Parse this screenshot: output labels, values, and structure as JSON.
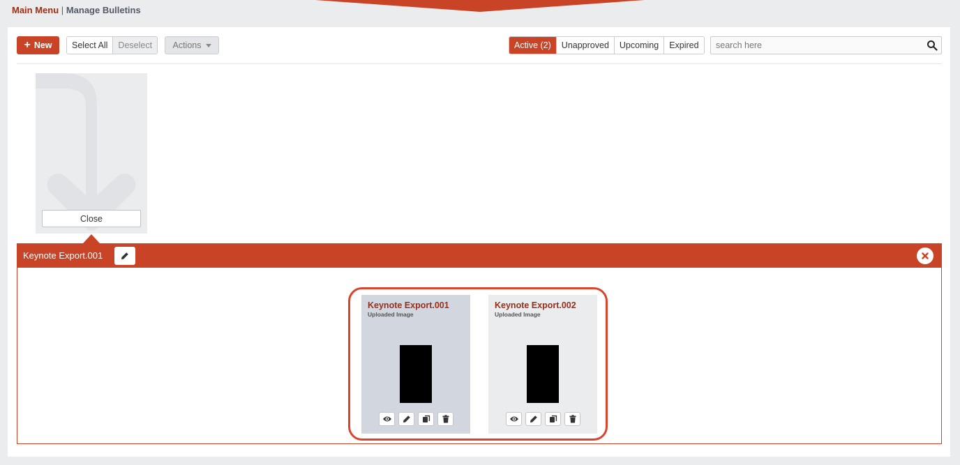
{
  "breadcrumb": {
    "main_menu": "Main Menu",
    "separator": "|",
    "current": "Manage Bulletins"
  },
  "colors": {
    "accent": "#c94426",
    "title_red": "#9c2e18",
    "highlight": "#d9442d",
    "page_bg": "#ebecee"
  },
  "toolbar": {
    "new_label": "New",
    "select_all_label": "Select All",
    "deselect_label": "Deselect",
    "actions_label": "Actions",
    "filters": [
      "Active (2)",
      "Unapproved",
      "Upcoming",
      "Expired"
    ],
    "active_filter": "Active (2)",
    "search_placeholder": "search here"
  },
  "folder_tile": {
    "icon": "arrow-down-icon",
    "close_label": "Close"
  },
  "group": {
    "title": "Keynote Export.001"
  },
  "cards": [
    {
      "title": "Keynote Export.001",
      "subtitle": "Uploaded Image",
      "selected": true
    },
    {
      "title": "Keynote Export.002",
      "subtitle": "Uploaded Image",
      "selected": false
    }
  ],
  "card_action_icons": [
    "eye-icon",
    "pencil-icon",
    "copy-icon",
    "trash-icon"
  ]
}
